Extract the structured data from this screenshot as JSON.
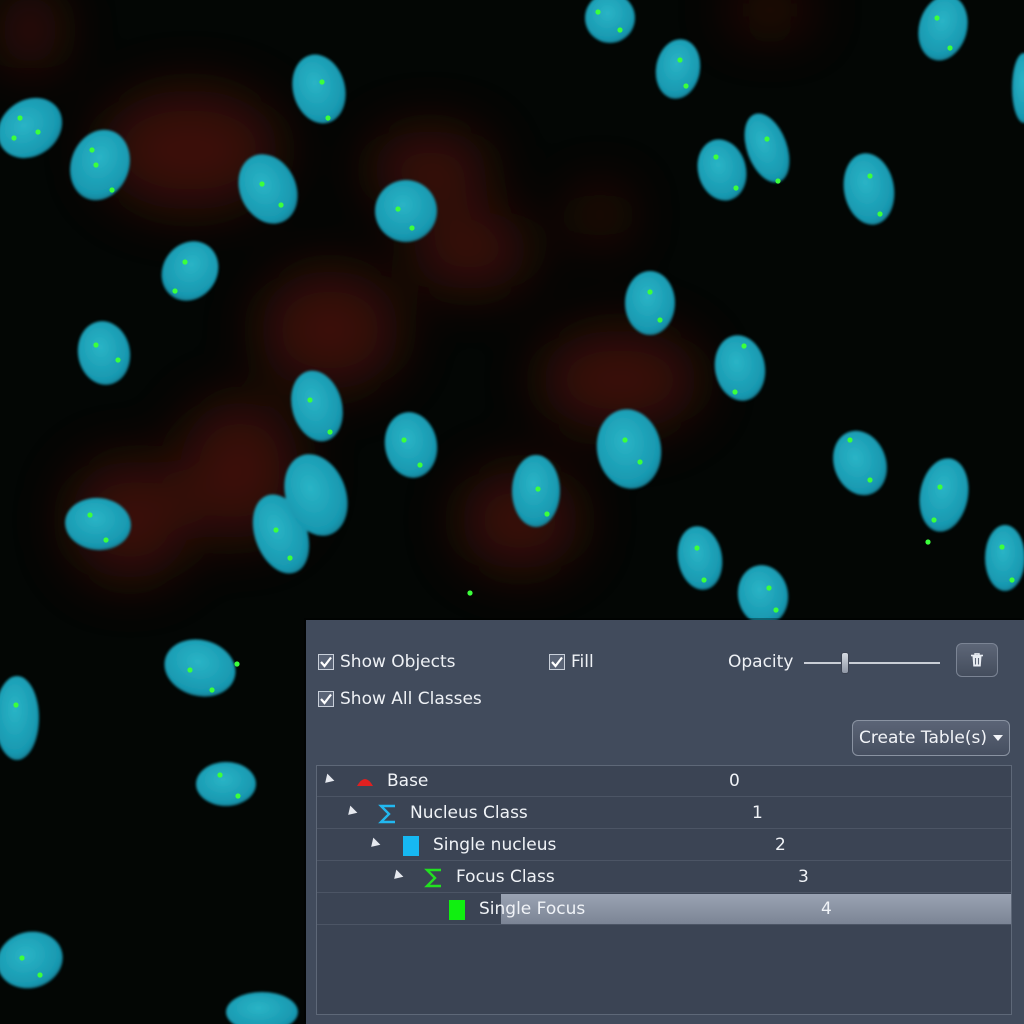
{
  "image_view": {
    "description_free": true
  },
  "panel": {
    "show_objects": {
      "label": "Show Objects",
      "checked": true
    },
    "fill": {
      "label": "Fill",
      "checked": true
    },
    "show_all_classes": {
      "label": "Show All Classes",
      "checked": true
    },
    "opacity": {
      "label": "Opacity",
      "value_fraction": 0.3
    },
    "delete_icon": "trash-icon",
    "create_table": {
      "label": "Create Table(s)"
    },
    "tree": [
      {
        "label": "Base",
        "value": "0",
        "icon": "base-icon",
        "icon_color": "#e02020"
      },
      {
        "label": "Nucleus Class",
        "value": "1",
        "icon": "sigma-icon",
        "icon_color": "#22b8f0"
      },
      {
        "label": "Single nucleus",
        "value": "2",
        "icon": "square-icon",
        "icon_color": "#16b8f2"
      },
      {
        "label": "Focus Class",
        "value": "3",
        "icon": "sigma-icon",
        "icon_color": "#22e020"
      },
      {
        "label": "Single Focus",
        "value": "4",
        "icon": "square-icon",
        "icon_color": "#10f010",
        "selected": true
      }
    ]
  },
  "colors": {
    "panel_bg": "#414b5c",
    "nucleus": "#18a6b8",
    "focus": "#3cff3c",
    "background": "#030604"
  }
}
